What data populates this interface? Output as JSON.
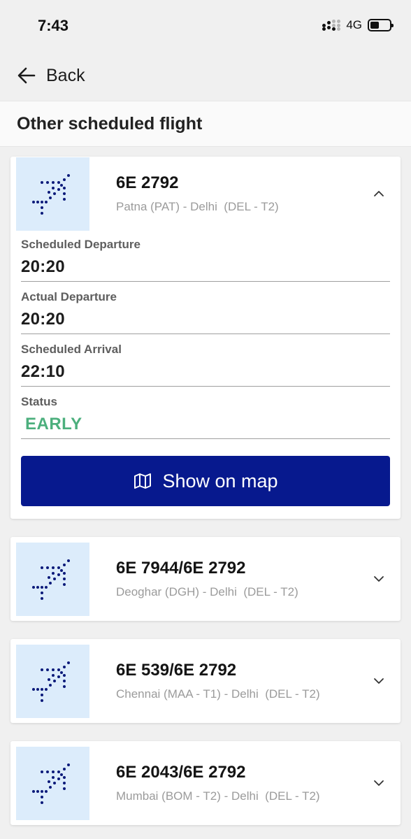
{
  "status_bar": {
    "time": "7:43",
    "network": "4G"
  },
  "nav": {
    "back_label": "Back"
  },
  "section": {
    "title": "Other scheduled flight"
  },
  "flights": [
    {
      "flight_no": "6E 2792",
      "route": "Patna (PAT) - Delhi  (DEL - T2)",
      "expanded": true,
      "details": {
        "scheduled_departure_label": "Scheduled Departure",
        "scheduled_departure": "20:20",
        "actual_departure_label": "Actual Departure",
        "actual_departure": "20:20",
        "scheduled_arrival_label": "Scheduled Arrival",
        "scheduled_arrival": "22:10",
        "status_label": "Status",
        "status": "EARLY"
      },
      "map_button_label": "Show on map"
    },
    {
      "flight_no": "6E 7944/6E 2792",
      "route": "Deoghar (DGH) - Delhi  (DEL - T2)",
      "expanded": false
    },
    {
      "flight_no": "6E 539/6E 2792",
      "route": "Chennai (MAA - T1) - Delhi  (DEL - T2)",
      "expanded": false
    },
    {
      "flight_no": "6E 2043/6E 2792",
      "route": "Mumbai (BOM - T2) - Delhi  (DEL - T2)",
      "expanded": false
    }
  ],
  "colors": {
    "brand_blue": "#07198e",
    "status_early": "#4caf7d",
    "thumb_bg": "#dcecfb",
    "page_bg": "#f0f0f0"
  },
  "icons": {
    "back": "arrow-left-icon",
    "flight": "plane-dots-icon",
    "expand": "chevron-up-icon",
    "collapse": "chevron-down-icon",
    "map": "map-icon"
  }
}
